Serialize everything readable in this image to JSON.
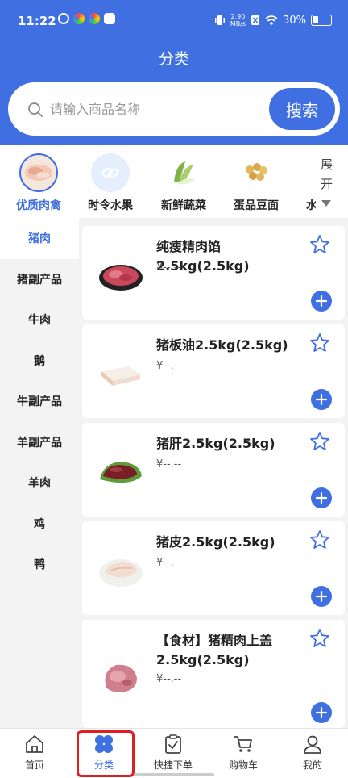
{
  "status": {
    "time": "11:22",
    "speed_value": "2.90",
    "speed_unit": "MB/s",
    "battery": "30%"
  },
  "header": {
    "title": "分类"
  },
  "search": {
    "placeholder": "请输入商品名称",
    "button": "搜索"
  },
  "categories": [
    {
      "label": "优质肉禽",
      "icon": "meat-icon",
      "active": true
    },
    {
      "label": "时令水果",
      "icon": "fruit-icon",
      "active": false
    },
    {
      "label": "新鲜蔬菜",
      "icon": "vegetable-icon",
      "active": false
    },
    {
      "label": "蛋品豆面",
      "icon": "bean-icon",
      "active": false
    },
    {
      "label": "水",
      "icon": "more-icon",
      "active": false
    }
  ],
  "expand": {
    "line1": "展",
    "line2": "开"
  },
  "sidebar": [
    {
      "label": "猪肉",
      "active": true
    },
    {
      "label": "猪副产品"
    },
    {
      "label": "牛肉"
    },
    {
      "label": "鹅"
    },
    {
      "label": "牛副产品"
    },
    {
      "label": "羊副产品"
    },
    {
      "label": "羊肉"
    },
    {
      "label": "鸡"
    },
    {
      "label": "鸭"
    }
  ],
  "products": [
    {
      "name": "纯瘦精肉馅2.5kg(2.5kg)",
      "price": "¥--.--",
      "image": "minced-pork-image"
    },
    {
      "name": "猪板油2.5kg(2.5kg)",
      "price": "¥--.--",
      "image": "pork-fat-image"
    },
    {
      "name": "猪肝2.5kg(2.5kg)",
      "price": "¥--.--",
      "image": "pork-liver-image"
    },
    {
      "name": "猪皮2.5kg(2.5kg)",
      "price": "¥--.--",
      "image": "pork-skin-image"
    },
    {
      "name": "【食材】猪精肉上盖2.5kg(2.5kg)",
      "price": "¥--.--",
      "image": "pork-lean-image"
    }
  ],
  "tabs": [
    {
      "label": "首页",
      "icon": "home-icon"
    },
    {
      "label": "分类",
      "icon": "category-icon",
      "active": true
    },
    {
      "label": "快捷下单",
      "icon": "quick-order-icon"
    },
    {
      "label": "购物车",
      "icon": "cart-icon"
    },
    {
      "label": "我的",
      "icon": "user-icon"
    }
  ],
  "colors": {
    "accent": "#3f6fe0",
    "highlight": "#e02020"
  }
}
